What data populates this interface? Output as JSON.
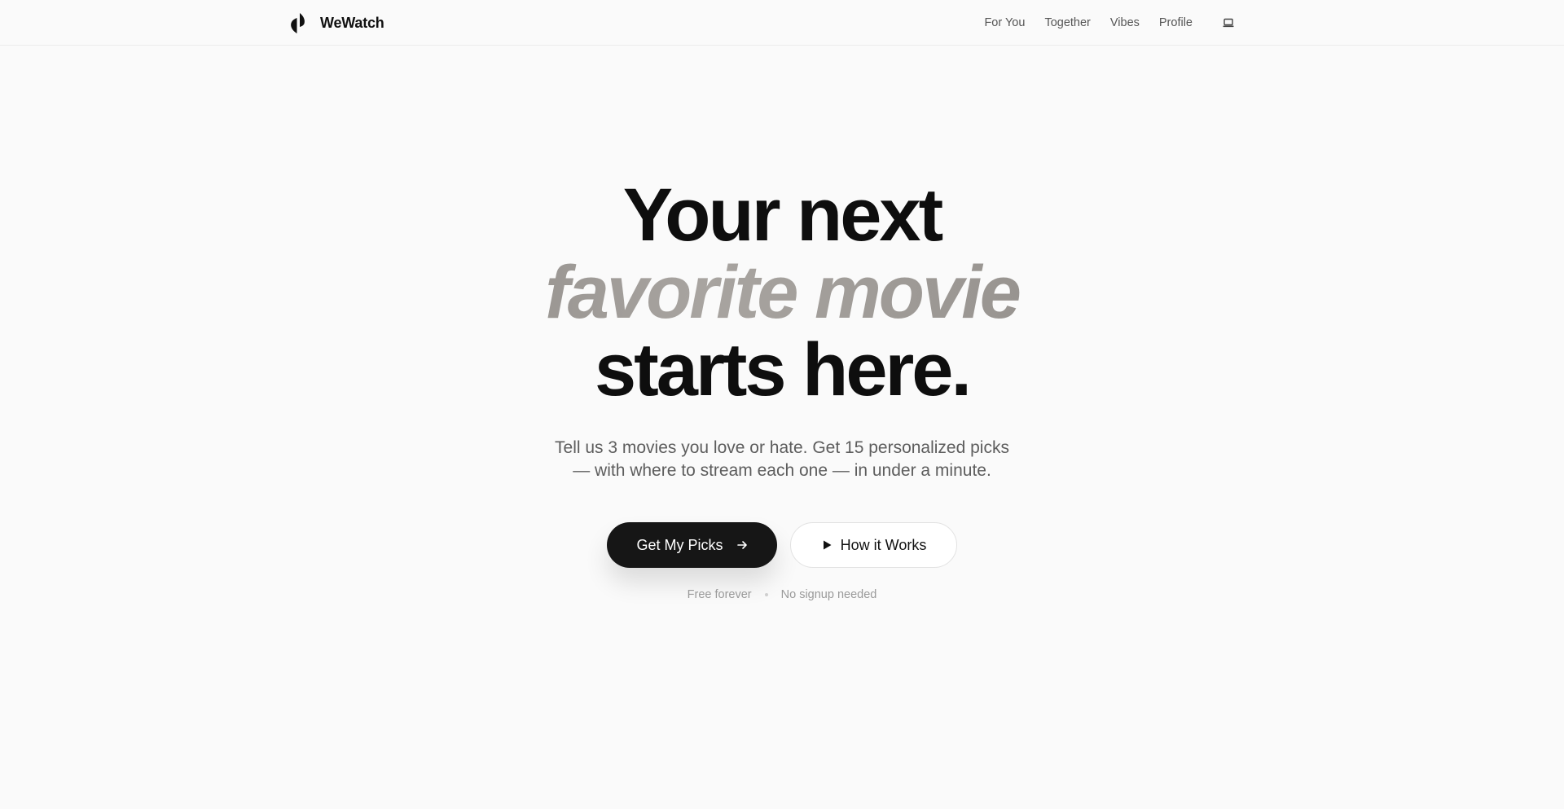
{
  "brand": {
    "name": "WeWatch",
    "logo_icon": "split-drop-logo-icon"
  },
  "nav": {
    "items": [
      {
        "label": "For You"
      },
      {
        "label": "Together"
      },
      {
        "label": "Vibes"
      },
      {
        "label": "Profile"
      }
    ],
    "device_icon": "laptop-icon"
  },
  "hero": {
    "headline_line1": "Your next",
    "headline_line2": "favorite movie",
    "headline_line3": "starts here.",
    "subtitle_line1": "Tell us 3 movies you love or hate. Get 15 personalized picks",
    "subtitle_line2": "— with where to stream each one — in under a minute."
  },
  "cta": {
    "primary_label": "Get My Picks",
    "primary_icon": "arrow-right-icon",
    "secondary_label": "How it Works",
    "secondary_icon": "play-icon"
  },
  "footnote": {
    "left": "Free forever",
    "right": "No signup needed"
  },
  "colors": {
    "background": "#fafafa",
    "primary_button": "#161616",
    "headline": "#0e0e0e",
    "accent_gradient_start": "#6f6b69",
    "accent_gradient_end": "#a8a4a0"
  }
}
